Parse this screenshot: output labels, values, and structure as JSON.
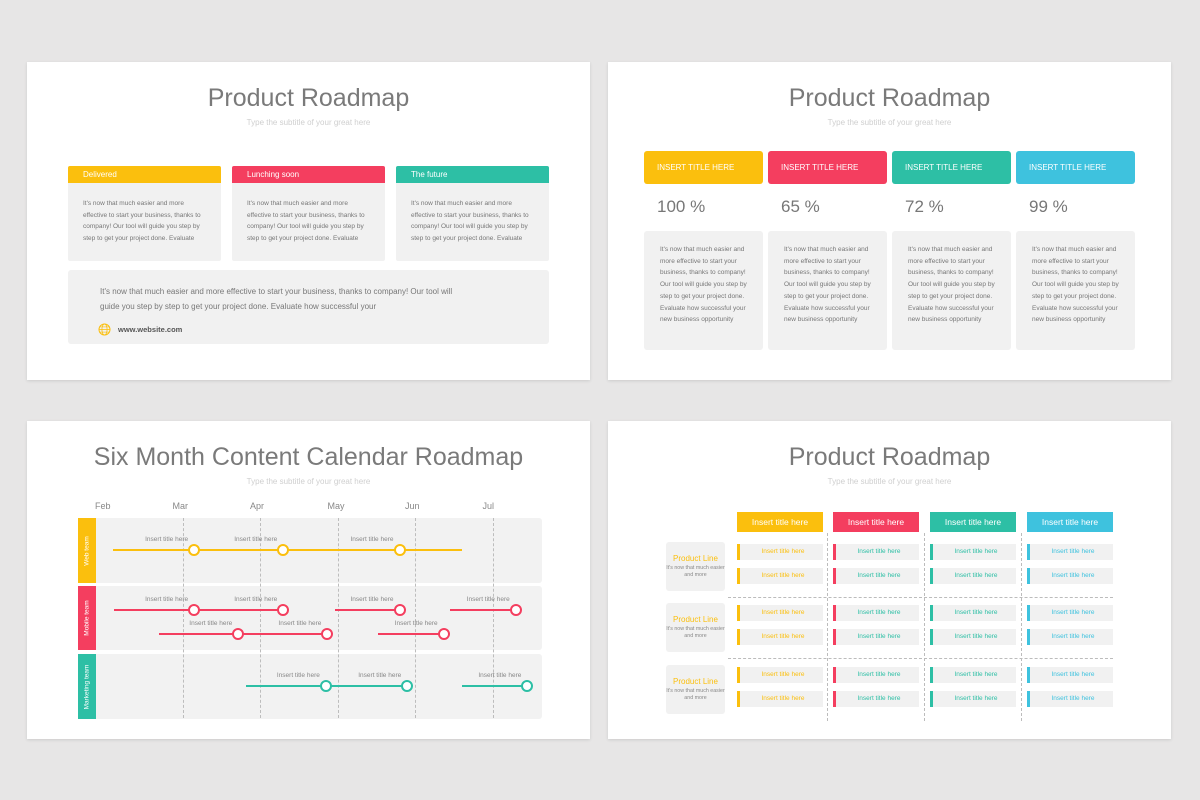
{
  "colors": {
    "yellow": "#fbbf0d",
    "red": "#f43e5f",
    "teal": "#2dbfa5",
    "blue": "#3ec2de",
    "title": "#7a7a7a",
    "card": "#f1f1f1",
    "background": "#e7e6e6"
  },
  "slide1": {
    "title": "Product Roadmap",
    "subtitle": "Type the subtitle of your great here",
    "cards": [
      {
        "label": "Delivered",
        "color": "yellow",
        "text": "It's now that much easier and more effective to start your business, thanks to company! Our tool will guide you step by step to get your project done. Evaluate"
      },
      {
        "label": "Lunching soon",
        "color": "red",
        "text": "It's now that much easier and more effective to start your business, thanks to company! Our tool will guide you step by step to get your project done. Evaluate"
      },
      {
        "label": "The future",
        "color": "teal",
        "text": "It's now that much easier and more effective to start your business, thanks to company! Our tool will guide you step by step to get your project done. Evaluate"
      }
    ],
    "footer": {
      "text": "It's now that much easier and more effective to start your business, thanks to company! Our tool will guide you step by step to get your project done. Evaluate how successful your",
      "icon": "globe-icon",
      "website": "www.website.com"
    }
  },
  "slide2": {
    "title": "Product Roadmap",
    "subtitle": "Type the subtitle of your great here",
    "columns": [
      {
        "label": "INSERT TITLE HERE",
        "color": "yellow",
        "percent": "100 %",
        "text": "It's now that much easier and more effective to start your business, thanks to company! Our tool will guide you step by step to get your project done. Evaluate how successful your new business opportunity"
      },
      {
        "label": "INSERT TITLE HERE",
        "color": "red",
        "percent": "65 %",
        "text": "It's now that much easier and more effective to start your business, thanks to company! Our tool will guide you step by step to get your project done. Evaluate how successful your new business opportunity"
      },
      {
        "label": "INSERT TITLE HERE",
        "color": "teal",
        "percent": "72 %",
        "text": "It's now that much easier and more effective to start your business, thanks to company! Our tool will guide you step by step to get your project done. Evaluate how successful your new business opportunity"
      },
      {
        "label": "INSERT TITLE HERE",
        "color": "blue",
        "percent": "99 %",
        "text": "It's now that much easier and more effective to start your business, thanks to company! Our tool will guide you step by step to get your project done. Evaluate how successful your new business opportunity"
      }
    ]
  },
  "slide3": {
    "title": "Six Month Content Calendar Roadmap",
    "subtitle": "Type the subtitle of your great here",
    "months": [
      "Feb",
      "Mar",
      "Apr",
      "May",
      "Jun",
      "Jul"
    ],
    "lanes": [
      {
        "name": "Web team",
        "color": "yellow",
        "tracks": [
          {
            "start": 0.1,
            "end": 4.6,
            "milestones": [
              {
                "at": 1.15,
                "label": "Insert title here"
              },
              {
                "at": 2.3,
                "label": "Insert title here"
              },
              {
                "at": 3.8,
                "label": "Insert title here"
              }
            ]
          }
        ]
      },
      {
        "name": "Mobile team",
        "color": "red",
        "tracks": [
          {
            "start": 0.12,
            "end": 2.3,
            "milestones": [
              {
                "at": 1.15,
                "label": "Insert title here"
              },
              {
                "at": 2.3,
                "label": "Insert title here"
              }
            ]
          },
          {
            "start": 2.97,
            "end": 3.8,
            "milestones": [
              {
                "at": 3.8,
                "label": "Insert title here"
              }
            ]
          },
          {
            "start": 4.45,
            "end": 5.3,
            "milestones": [
              {
                "at": 5.3,
                "label": "Insert title here"
              }
            ]
          },
          {
            "start": 0.7,
            "end": 2.87,
            "row": 1,
            "milestones": [
              {
                "at": 1.72,
                "label": "Insert title here"
              },
              {
                "at": 2.87,
                "label": "Insert title here"
              }
            ]
          },
          {
            "start": 3.52,
            "end": 4.37,
            "row": 1,
            "milestones": [
              {
                "at": 4.37,
                "label": "Insert title here"
              }
            ]
          }
        ]
      },
      {
        "name": "Marketing team",
        "color": "teal",
        "tracks": [
          {
            "start": 1.82,
            "end": 3.9,
            "milestones": [
              {
                "at": 2.85,
                "label": "Insert title here"
              },
              {
                "at": 3.9,
                "label": "Insert title here"
              }
            ]
          },
          {
            "start": 4.6,
            "end": 5.45,
            "milestones": [
              {
                "at": 5.45,
                "label": "Insert title here"
              }
            ]
          }
        ]
      }
    ]
  },
  "slide4": {
    "title": "Product Roadmap",
    "subtitle": "Type the subtitle of your great here",
    "columns": [
      {
        "label": "Insert title here",
        "color": "yellow"
      },
      {
        "label": "Insert title here",
        "color": "red"
      },
      {
        "label": "Insert title here",
        "color": "teal"
      },
      {
        "label": "Insert title here",
        "color": "blue"
      }
    ],
    "rows": [
      {
        "label": "Product Line",
        "desc": "It's now that much easier and more",
        "cells": [
          [
            "Insert title here",
            "Insert title here"
          ],
          [
            "Insert title here",
            "Insert title here"
          ],
          [
            "Insert title here",
            "Insert title here"
          ],
          [
            "Insert title here",
            "Insert title here"
          ]
        ]
      },
      {
        "label": "Product Line",
        "desc": "It's now that much easier and more",
        "cells": [
          [
            "Insert title here",
            "Insert title here"
          ],
          [
            "Insert title here",
            "Insert title here"
          ],
          [
            "Insert title here",
            "Insert title here"
          ],
          [
            "Insert title here",
            "Insert title here"
          ]
        ]
      },
      {
        "label": "Product Line",
        "desc": "It's now that much easier and more",
        "cells": [
          [
            "Insert title here",
            "Insert title here"
          ],
          [
            "Insert title here",
            "Insert title here"
          ],
          [
            "Insert title here",
            "Insert title here"
          ],
          [
            "Insert title here",
            "Insert title here"
          ]
        ]
      }
    ]
  }
}
